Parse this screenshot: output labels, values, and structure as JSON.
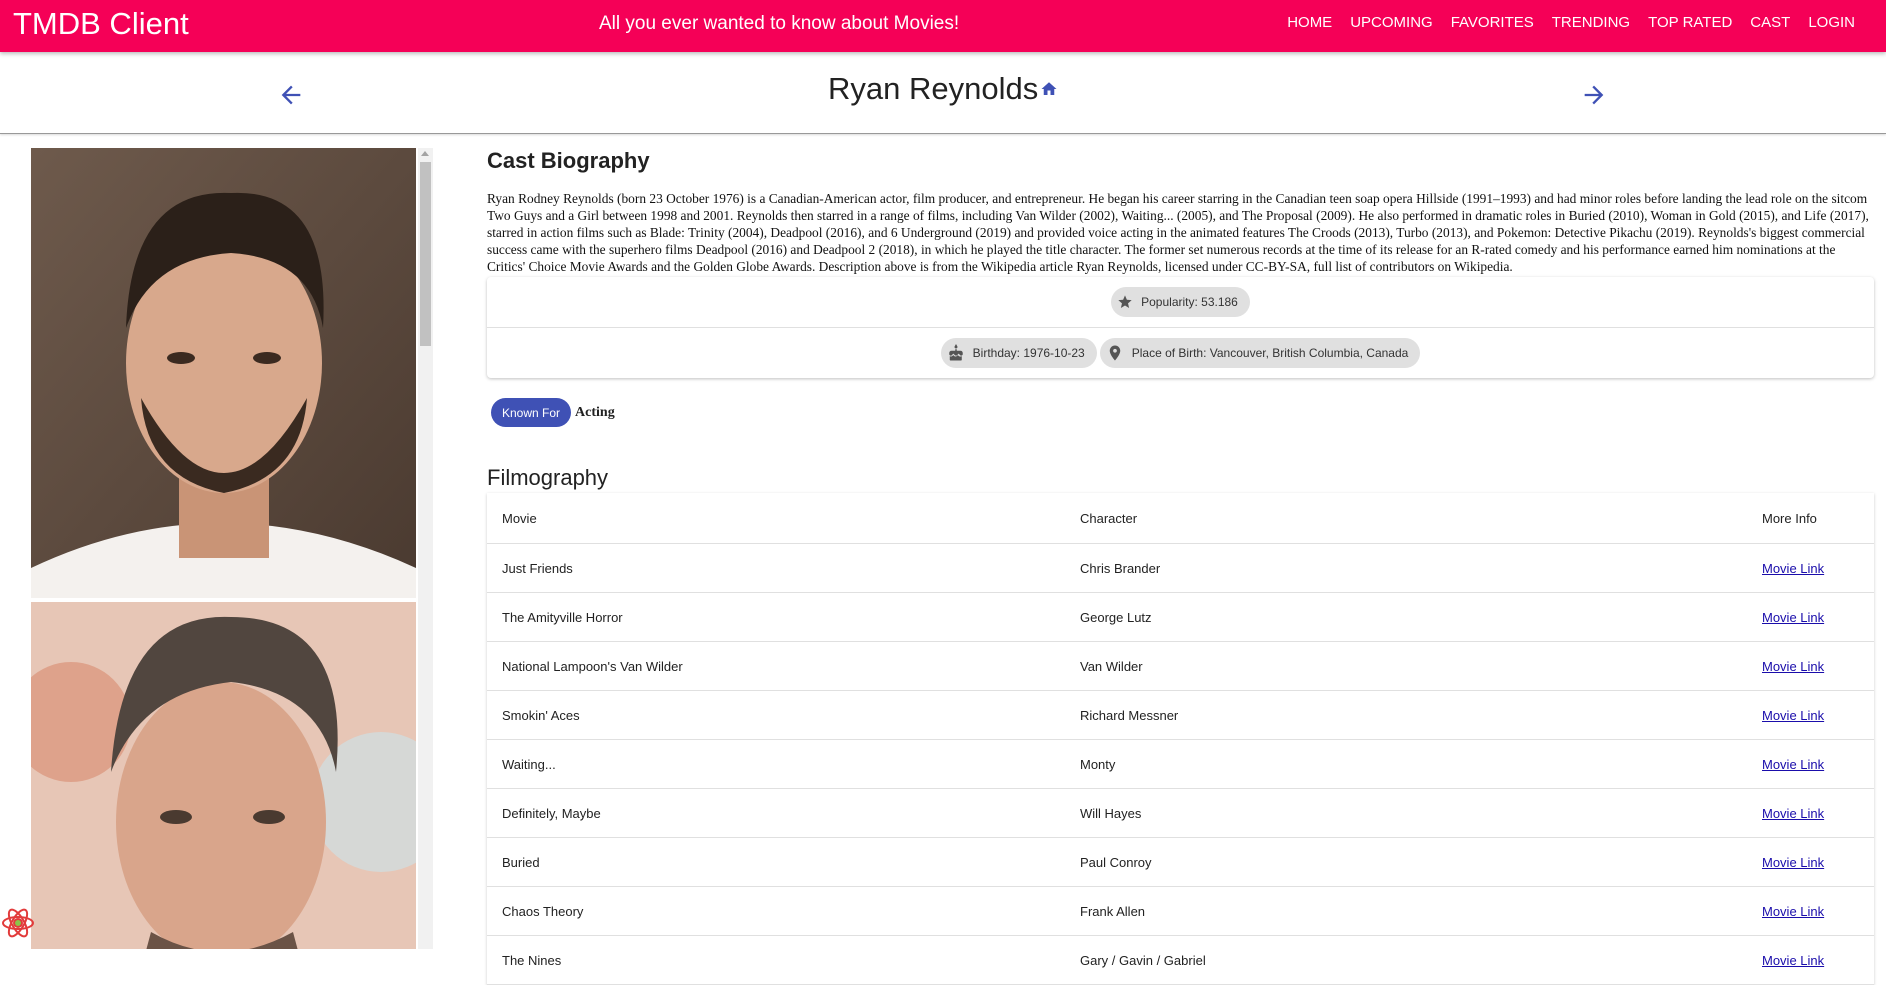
{
  "app": {
    "brand": "TMDB Client",
    "tagline": "All you ever wanted to know about Movies!",
    "accent_color": "#f50057",
    "nav": [
      "Home",
      "Upcoming",
      "Favorites",
      "Trending",
      "Top Rated",
      "Cast",
      "Login"
    ]
  },
  "header": {
    "title": "Ryan Reynolds",
    "back_icon": "arrow-left-icon",
    "forward_icon": "arrow-right-icon",
    "home_icon": "home-icon"
  },
  "biography": {
    "heading": "Cast Biography",
    "text": "Ryan Rodney Reynolds (born 23 October 1976) is a Canadian-American actor, film producer, and entrepreneur. He began his career starring in the Canadian teen soap opera Hillside (1991–1993) and had minor roles before landing the lead role on the sitcom Two Guys and a Girl between 1998 and 2001. Reynolds then starred in a range of films, including Van Wilder (2002), Waiting... (2005), and The Proposal (2009). He also performed in dramatic roles in Buried (2010), Woman in Gold (2015), and Life (2017), starred in action films such as Blade: Trinity (2004), Deadpool (2016), and 6 Underground (2019) and provided voice acting in the animated features The Croods (2013), Turbo (2013), and Pokemon: Detective Pikachu (2019). Reynolds's biggest commercial success came with the superhero films Deadpool (2016) and Deadpool 2 (2018), in which he played the title character. The former set numerous records at the time of its release for an R-rated comedy and his performance earned him nominations at the Critics' Choice Movie Awards and the Golden Globe Awards. Description above is from the Wikipedia article Ryan Reynolds, licensed under CC-BY-SA, full list of contributors on Wikipedia."
  },
  "chips": {
    "popularity": "Popularity: 53.186",
    "birthday": "Birthday: 1976-10-23",
    "place_of_birth": "Place of Birth: Vancouver, British Columbia, Canada"
  },
  "known_for": {
    "label": "Known For",
    "value": "Acting",
    "chip_color": "#3f51b5"
  },
  "filmography": {
    "heading": "Filmography",
    "columns": [
      "Movie",
      "Character",
      "More Info"
    ],
    "rows": [
      {
        "movie": "Just Friends",
        "character": "Chris Brander",
        "link": "Movie Link"
      },
      {
        "movie": "The Amityville Horror",
        "character": "George Lutz",
        "link": "Movie Link"
      },
      {
        "movie": "National Lampoon's Van Wilder",
        "character": "Van Wilder",
        "link": "Movie Link"
      },
      {
        "movie": "Smokin' Aces",
        "character": "Richard Messner",
        "link": "Movie Link"
      },
      {
        "movie": "Waiting...",
        "character": "Monty",
        "link": "Movie Link"
      },
      {
        "movie": "Definitely, Maybe",
        "character": "Will Hayes",
        "link": "Movie Link"
      },
      {
        "movie": "Buried",
        "character": "Paul Conroy",
        "link": "Movie Link"
      },
      {
        "movie": "Chaos Theory",
        "character": "Frank Allen",
        "link": "Movie Link"
      },
      {
        "movie": "The Nines",
        "character": "Gary / Gavin / Gabriel",
        "link": "Movie Link"
      }
    ]
  }
}
